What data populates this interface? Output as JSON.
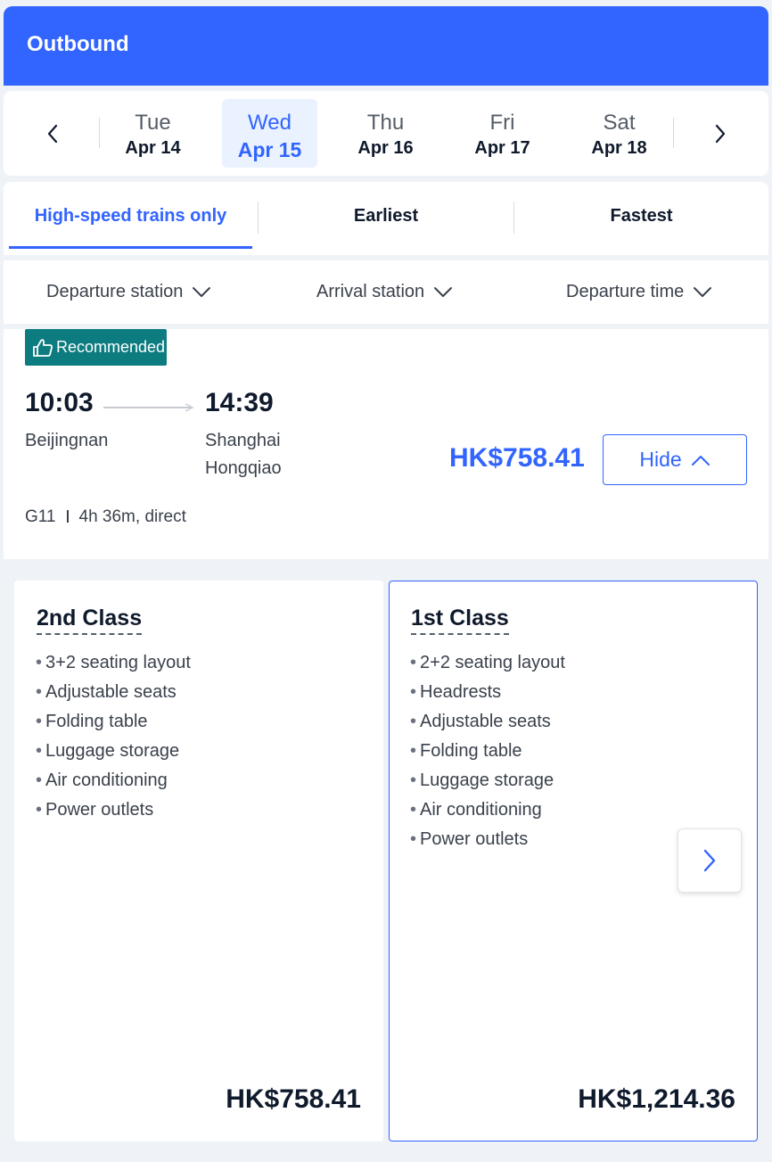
{
  "header": {
    "title": "Outbound"
  },
  "dates": [
    {
      "dow": "Tue",
      "date": "Apr 14"
    },
    {
      "dow": "Wed",
      "date": "Apr 15",
      "selected": true
    },
    {
      "dow": "Thu",
      "date": "Apr 16"
    },
    {
      "dow": "Fri",
      "date": "Apr 17"
    },
    {
      "dow": "Sat",
      "date": "Apr 18"
    }
  ],
  "tabs": [
    {
      "label": "High-speed trains only",
      "active": true
    },
    {
      "label": "Earliest"
    },
    {
      "label": "Fastest"
    }
  ],
  "filters": [
    {
      "label": "Departure station"
    },
    {
      "label": "Arrival station"
    },
    {
      "label": "Departure time"
    }
  ],
  "result": {
    "badge": "Recommended",
    "depart_time": "10:03",
    "arrive_time": "14:39",
    "depart_station": "Beijingnan",
    "arrive_station_line1": "Shanghai",
    "arrive_station_line2": "Hongqiao",
    "price": "HK$758.41",
    "hide_label": "Hide",
    "train_no": "G11",
    "duration": "4h 36m, direct"
  },
  "classes": [
    {
      "name": "2nd Class",
      "features": [
        "3+2 seating layout",
        "Adjustable seats",
        "Folding table",
        "Luggage storage",
        "Air conditioning",
        "Power outlets"
      ],
      "price": "HK$758.41"
    },
    {
      "name": "1st Class",
      "features": [
        "2+2 seating layout",
        "Headrests",
        "Adjustable seats",
        "Folding table",
        "Luggage storage",
        "Air conditioning",
        "Power outlets"
      ],
      "price": "HK$1,214.36"
    }
  ],
  "colors": {
    "accent": "#3264ff",
    "badge": "#0d7c80",
    "text": "#0f1a2c"
  },
  "icons": [
    "chevron-left-icon",
    "chevron-right-icon",
    "chevron-down-icon",
    "chevron-up-icon",
    "thumbs-up-icon"
  ]
}
